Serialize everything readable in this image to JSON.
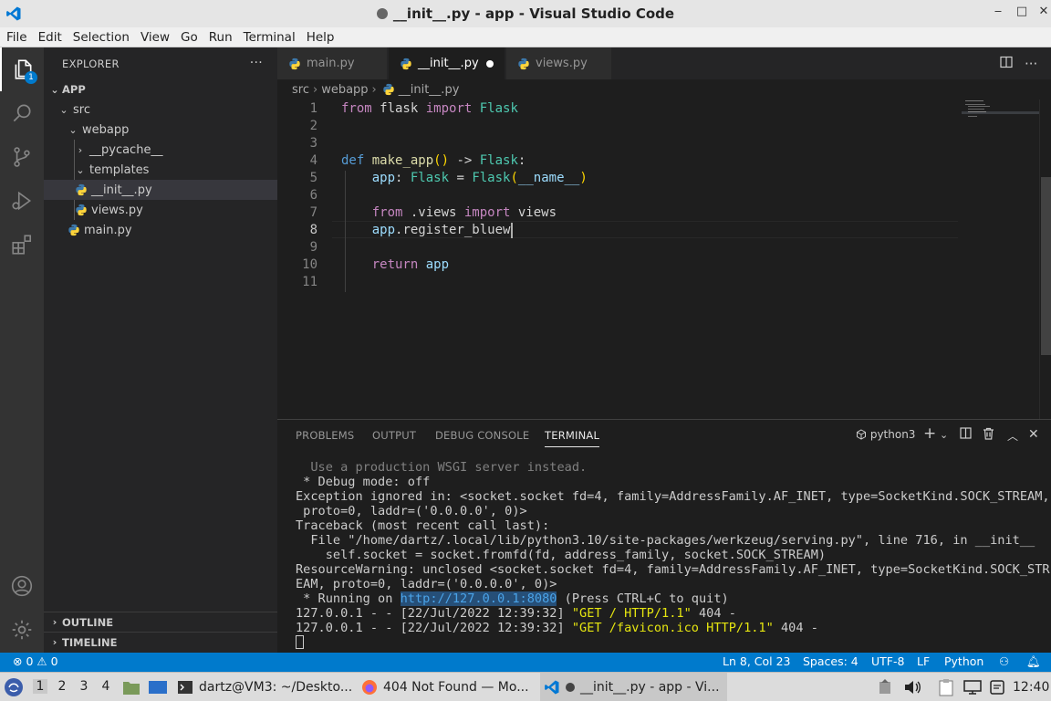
{
  "window": {
    "title": "__init__.py - app - Visual Studio Code",
    "controls": [
      "‒",
      "□",
      "✕"
    ]
  },
  "menu": [
    "File",
    "Edit",
    "Selection",
    "View",
    "Go",
    "Run",
    "Terminal",
    "Help"
  ],
  "activity_bar": {
    "explorer_badge": "1"
  },
  "sidebar": {
    "title": "EXPLORER",
    "more": "···",
    "root": "APP",
    "tree": [
      {
        "label": "src",
        "chevron": "⌄"
      },
      {
        "label": "webapp",
        "chevron": "⌄"
      },
      {
        "label": "__pycache__",
        "chevron": "›"
      },
      {
        "label": "templates",
        "chevron": "⌄"
      },
      {
        "label": "__init__.py"
      },
      {
        "label": "views.py"
      },
      {
        "label": "main.py"
      }
    ],
    "outline": "OUTLINE",
    "timeline": "TIMELINE"
  },
  "tabs": [
    {
      "label": "main.py"
    },
    {
      "label": "__init__.py"
    },
    {
      "label": "views.py"
    }
  ],
  "breadcrumb": [
    "src",
    "webapp",
    "__init__.py"
  ],
  "code": {
    "line_numbers": [
      "1",
      "2",
      "3",
      "4",
      "5",
      "6",
      "7",
      "8",
      "9",
      "10",
      "11"
    ],
    "lines": {
      "l1": {
        "a": "from",
        "b": " flask ",
        "c": "import",
        "d": " Flask"
      },
      "l4": {
        "a": "def",
        "b": " ",
        "c": "make_app",
        "d": "()",
        "e": " -> ",
        "f": "Flask",
        "g": ":"
      },
      "l5": {
        "a": "    app",
        "b": ": ",
        "c": "Flask",
        "d": " = ",
        "e": "Flask",
        "f": "(",
        "g": "__name__",
        "h": ")"
      },
      "l7": {
        "a": "    ",
        "b": "from",
        "c": " .views ",
        "d": "import",
        "e": " views"
      },
      "l8": {
        "a": "    app",
        "b": ".register_bluew"
      },
      "l10": {
        "a": "    ",
        "b": "return",
        "c": " app"
      }
    }
  },
  "panel": {
    "tabs": [
      "PROBLEMS",
      "OUTPUT",
      "DEBUG CONSOLE",
      "TERMINAL"
    ],
    "shell": "python3",
    "terminal": {
      "t1": "  Use a production WSGI server instead.",
      "t2": " * Debug mode: off",
      "t3": "Exception ignored in: <socket.socket fd=4, family=AddressFamily.AF_INET, type=SocketKind.SOCK_STREAM,",
      "t4": " proto=0, laddr=('0.0.0.0', 0)>",
      "t5": "Traceback (most recent call last):",
      "t6": "  File \"/home/dartz/.local/lib/python3.10/site-packages/werkzeug/serving.py\", line 716, in __init__",
      "t7": "    self.socket = socket.fromfd(fd, address_family, socket.SOCK_STREAM)",
      "t8": "ResourceWarning: unclosed <socket.socket fd=4, family=AddressFamily.AF_INET, type=SocketKind.SOCK_STR",
      "t9": "EAM, proto=0, laddr=('0.0.0.0', 0)>",
      "t10a": " * Running on ",
      "t10b": "http://127.0.0.1:8080",
      "t10c": " (Press CTRL+C to quit)",
      "t11a": "127.0.0.1 - - [22/Jul/2022 12:39:32] ",
      "t11b": "\"GET / HTTP/1.1\"",
      "t11c": " 404 -",
      "t12a": "127.0.0.1 - - [22/Jul/2022 12:39:32] ",
      "t12b": "\"GET /favicon.ico HTTP/1.1\"",
      "t12c": " 404 -"
    }
  },
  "statusbar": {
    "errors": "0",
    "warnings": "0",
    "position": "Ln 8, Col 23",
    "spaces": "Spaces: 4",
    "encoding": "UTF-8",
    "eol": "LF",
    "language": "Python"
  },
  "taskbar": {
    "workspaces": [
      "1",
      "2",
      "3",
      "4"
    ],
    "terminal": "dartz@VM3: ~/Deskto...",
    "firefox": "404 Not Found — Mo...",
    "vscode": "__init__.py - app - Vi...",
    "clock": "12:40"
  }
}
